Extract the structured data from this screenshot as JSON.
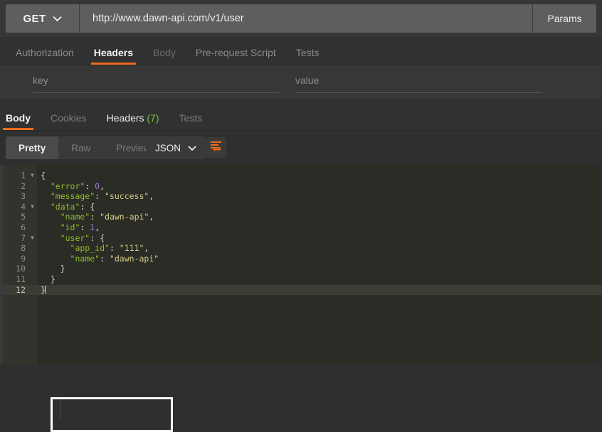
{
  "request": {
    "method": "GET",
    "method_caret_icon": "chevron-down-icon",
    "url": "http://www.dawn-api.com/v1/user",
    "params_label": "Params",
    "tabs": [
      {
        "label": "Authorization",
        "active": false,
        "dim": false
      },
      {
        "label": "Headers",
        "active": true,
        "dim": false
      },
      {
        "label": "Body",
        "active": false,
        "dim": true
      },
      {
        "label": "Pre-request Script",
        "active": false,
        "dim": false
      },
      {
        "label": "Tests",
        "active": false,
        "dim": false
      }
    ],
    "key_placeholder": "key",
    "value_placeholder": "value"
  },
  "response": {
    "tabs": [
      {
        "label": "Body",
        "active": true,
        "count": ""
      },
      {
        "label": "Cookies",
        "active": false,
        "count": ""
      },
      {
        "label": "Headers",
        "active": false,
        "count": "(7)"
      },
      {
        "label": "Tests",
        "active": false,
        "count": ""
      }
    ],
    "view_modes": [
      {
        "label": "Pretty",
        "active": true
      },
      {
        "label": "Raw",
        "active": false
      },
      {
        "label": "Preview",
        "active": false
      }
    ],
    "format": "JSON",
    "format_caret_icon": "chevron-down-icon",
    "wrap_icon": "word-wrap-icon"
  },
  "editor": {
    "active_line": 12,
    "fold_lines": [
      1,
      4,
      7
    ],
    "lines": [
      {
        "n": 1,
        "tokens": [
          {
            "t": "{",
            "c": "p"
          }
        ]
      },
      {
        "n": 2,
        "tokens": [
          {
            "t": "  \"error\"",
            "c": "k"
          },
          {
            "t": ": ",
            "c": "p"
          },
          {
            "t": "0",
            "c": "n"
          },
          {
            "t": ",",
            "c": "p"
          }
        ]
      },
      {
        "n": 3,
        "tokens": [
          {
            "t": "  \"message\"",
            "c": "k"
          },
          {
            "t": ": ",
            "c": "p"
          },
          {
            "t": "\"success\"",
            "c": "s"
          },
          {
            "t": ",",
            "c": "p"
          }
        ]
      },
      {
        "n": 4,
        "tokens": [
          {
            "t": "  \"data\"",
            "c": "k"
          },
          {
            "t": ": {",
            "c": "p"
          }
        ]
      },
      {
        "n": 5,
        "tokens": [
          {
            "t": "    \"name\"",
            "c": "k"
          },
          {
            "t": ": ",
            "c": "p"
          },
          {
            "t": "\"dawn-api\"",
            "c": "s"
          },
          {
            "t": ",",
            "c": "p"
          }
        ]
      },
      {
        "n": 6,
        "tokens": [
          {
            "t": "    \"id\"",
            "c": "k"
          },
          {
            "t": ": ",
            "c": "p"
          },
          {
            "t": "1",
            "c": "n"
          },
          {
            "t": ",",
            "c": "p"
          }
        ]
      },
      {
        "n": 7,
        "tokens": [
          {
            "t": "    \"user\"",
            "c": "k"
          },
          {
            "t": ": {",
            "c": "p"
          }
        ]
      },
      {
        "n": 8,
        "tokens": [
          {
            "t": "      \"app_id\"",
            "c": "k"
          },
          {
            "t": ": ",
            "c": "p"
          },
          {
            "t": "\"111\"",
            "c": "s"
          },
          {
            "t": ",",
            "c": "p"
          }
        ]
      },
      {
        "n": 9,
        "tokens": [
          {
            "t": "      \"name\"",
            "c": "k"
          },
          {
            "t": ": ",
            "c": "p"
          },
          {
            "t": "\"dawn-api\"",
            "c": "s"
          }
        ]
      },
      {
        "n": 10,
        "tokens": [
          {
            "t": "    }",
            "c": "p"
          }
        ]
      },
      {
        "n": 11,
        "tokens": [
          {
            "t": "  }",
            "c": "p"
          }
        ]
      },
      {
        "n": 12,
        "tokens": [
          {
            "t": "}",
            "c": "p"
          }
        ]
      }
    ]
  },
  "highlight": {
    "name": "user-object-highlight",
    "color": "#ffffff"
  },
  "colors": {
    "accent": "#ef6c1a",
    "count_green": "#74c043",
    "key_green": "#8fbb2a",
    "string_tan": "#d6cc8a",
    "number_purple": "#9a72d6",
    "editor_bg": "#2b2c26"
  }
}
